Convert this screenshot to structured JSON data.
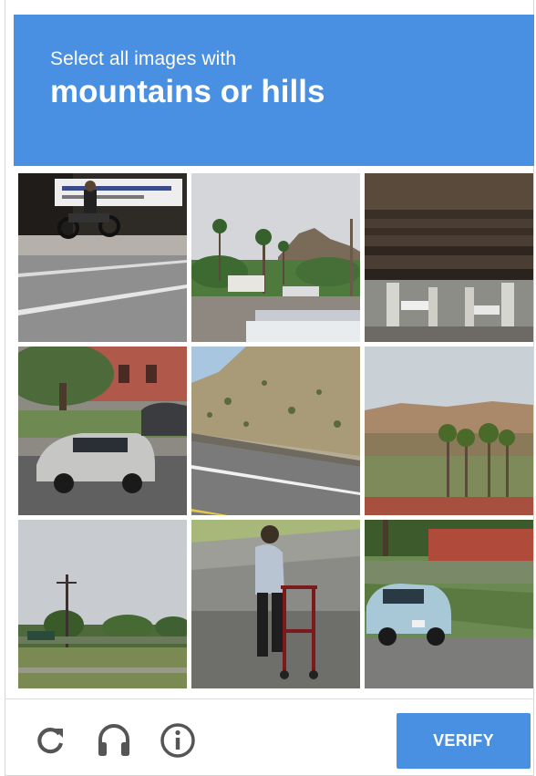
{
  "header": {
    "instruction": "Select all images with",
    "target": "mountains or hills",
    "background_color": "#4a90e2"
  },
  "grid": {
    "rows": 3,
    "columns": 3,
    "tiles": [
      {
        "row": 1,
        "col": 1,
        "scene": "motorcyclist-street"
      },
      {
        "row": 1,
        "col": 2,
        "scene": "palm-trees-hill"
      },
      {
        "row": 1,
        "col": 3,
        "scene": "under-bridge"
      },
      {
        "row": 2,
        "col": 1,
        "scene": "parked-silver-car"
      },
      {
        "row": 2,
        "col": 2,
        "scene": "rocky-hillside-road"
      },
      {
        "row": 2,
        "col": 3,
        "scene": "desert-hills-palms"
      },
      {
        "row": 3,
        "col": 1,
        "scene": "field-utility-pole"
      },
      {
        "row": 3,
        "col": 2,
        "scene": "person-with-walker"
      },
      {
        "row": 3,
        "col": 3,
        "scene": "light-blue-car"
      }
    ]
  },
  "footer": {
    "reload_icon": "reload-icon",
    "audio_icon": "headphones-icon",
    "info_icon": "info-icon",
    "verify_label": "VERIFY",
    "icon_color": "#555555"
  }
}
